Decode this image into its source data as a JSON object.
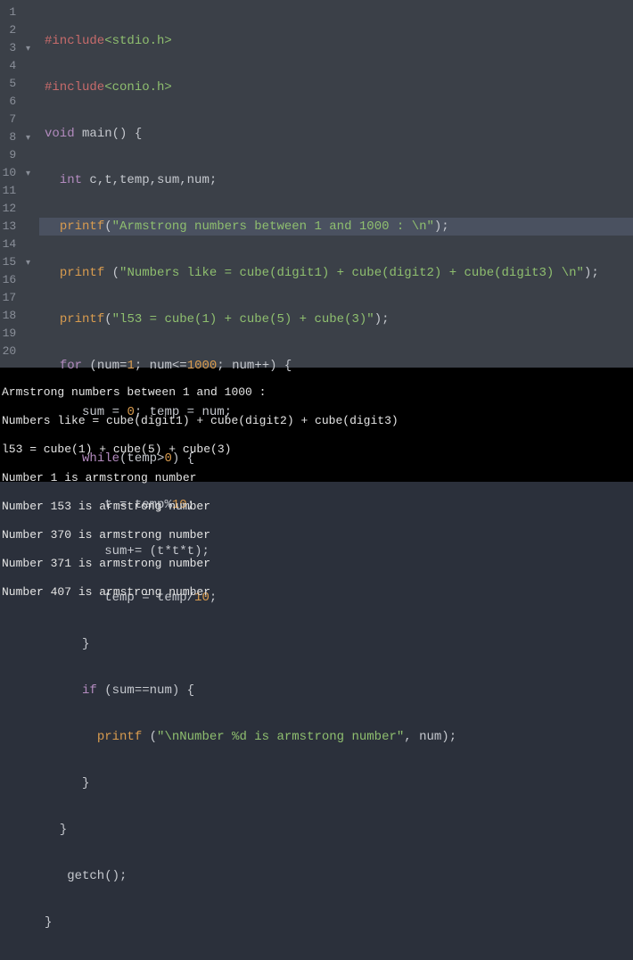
{
  "editor": {
    "lines": [
      {
        "n": "1",
        "fold": "",
        "hl": false
      },
      {
        "n": "2",
        "fold": "",
        "hl": false
      },
      {
        "n": "3",
        "fold": "▾",
        "hl": false
      },
      {
        "n": "4",
        "fold": "",
        "hl": false
      },
      {
        "n": "5",
        "fold": "",
        "hl": true
      },
      {
        "n": "6",
        "fold": "",
        "hl": false
      },
      {
        "n": "7",
        "fold": "",
        "hl": false
      },
      {
        "n": "8",
        "fold": "▾",
        "hl": false
      },
      {
        "n": "9",
        "fold": "",
        "hl": false
      },
      {
        "n": "10",
        "fold": "▾",
        "hl": false
      },
      {
        "n": "11",
        "fold": "",
        "hl": false
      },
      {
        "n": "12",
        "fold": "",
        "hl": false
      },
      {
        "n": "13",
        "fold": "",
        "hl": false
      },
      {
        "n": "14",
        "fold": "",
        "hl": false
      },
      {
        "n": "15",
        "fold": "▾",
        "hl": false
      },
      {
        "n": "16",
        "fold": "",
        "hl": false
      },
      {
        "n": "17",
        "fold": "",
        "hl": false
      },
      {
        "n": "18",
        "fold": "",
        "hl": false
      },
      {
        "n": "19",
        "fold": "",
        "hl": false
      },
      {
        "n": "20",
        "fold": "",
        "hl": false
      }
    ],
    "tokens": {
      "l1": {
        "a": "#include",
        "b": "<stdio.h>"
      },
      "l2": {
        "a": "#include",
        "b": "<conio.h>"
      },
      "l3": {
        "a": "void",
        "b": " main() {"
      },
      "l4": {
        "a": "  int",
        "b": " c,t,temp,sum,num;"
      },
      "l5": {
        "a": "  ",
        "b": "printf",
        "c": "(",
        "d": "\"Armstrong numbers between 1 and 1000 : \\n\"",
        "e": ");"
      },
      "l6": {
        "a": "  ",
        "b": "printf",
        "c": " (",
        "d": "\"Numbers like = cube(digit1) + cube(digit2) + cube(digit3) \\n\"",
        "e": ");"
      },
      "l7": {
        "a": "  ",
        "b": "printf",
        "c": "(",
        "d": "\"l53 = cube(1) + cube(5) + cube(3)\"",
        "e": ");"
      },
      "l8": {
        "a": "  ",
        "b": "for",
        "c": " (num",
        "d": "=",
        "e": "1",
        "f": "; num",
        "g": "<=",
        "h": "1000",
        "i": "; num",
        "j": "++",
        "k": ") {"
      },
      "l9": {
        "a": "     sum ",
        "b": "=",
        "c": " ",
        "d": "0",
        "e": "; temp ",
        "f": "=",
        "g": " num;"
      },
      "l10": {
        "a": "     ",
        "b": "while",
        "c": "(temp",
        "d": ">",
        "e": "0",
        "f": ") {"
      },
      "l11": {
        "a": "        t ",
        "b": "=",
        "c": " temp",
        "d": "%",
        "e": "10",
        "f": ";"
      },
      "l12": {
        "a": "        sum",
        "b": "+=",
        "c": " (t",
        "d": "*",
        "e": "t",
        "f": "*",
        "g": "t);"
      },
      "l13": {
        "a": "        temp ",
        "b": "=",
        "c": " temp",
        "d": "/",
        "e": "10",
        "f": ";"
      },
      "l14": {
        "a": "     }"
      },
      "l15": {
        "a": "     ",
        "b": "if",
        "c": " (sum",
        "d": "==",
        "e": "num) {"
      },
      "l16": {
        "a": "       ",
        "b": "printf",
        "c": " (",
        "d": "\"\\nNumber %d is armstrong number\"",
        "e": ", num);"
      },
      "l17": {
        "a": "     }"
      },
      "l18": {
        "a": "  }"
      },
      "l19": {
        "a": "   getch();"
      },
      "l20": {
        "a": "}"
      }
    }
  },
  "terminal": {
    "l1": "Armstrong numbers between 1 and 1000 :",
    "l2": "Numbers like = cube(digit1) + cube(digit2) + cube(digit3)",
    "l3": "l53 = cube(1) + cube(5) + cube(3)",
    "l4": "Number 1 is armstrong number",
    "l5": "Number 153 is armstrong number",
    "l6": "Number 370 is armstrong number",
    "l7": "Number 371 is armstrong number",
    "l8": "Number 407 is armstrong number"
  }
}
